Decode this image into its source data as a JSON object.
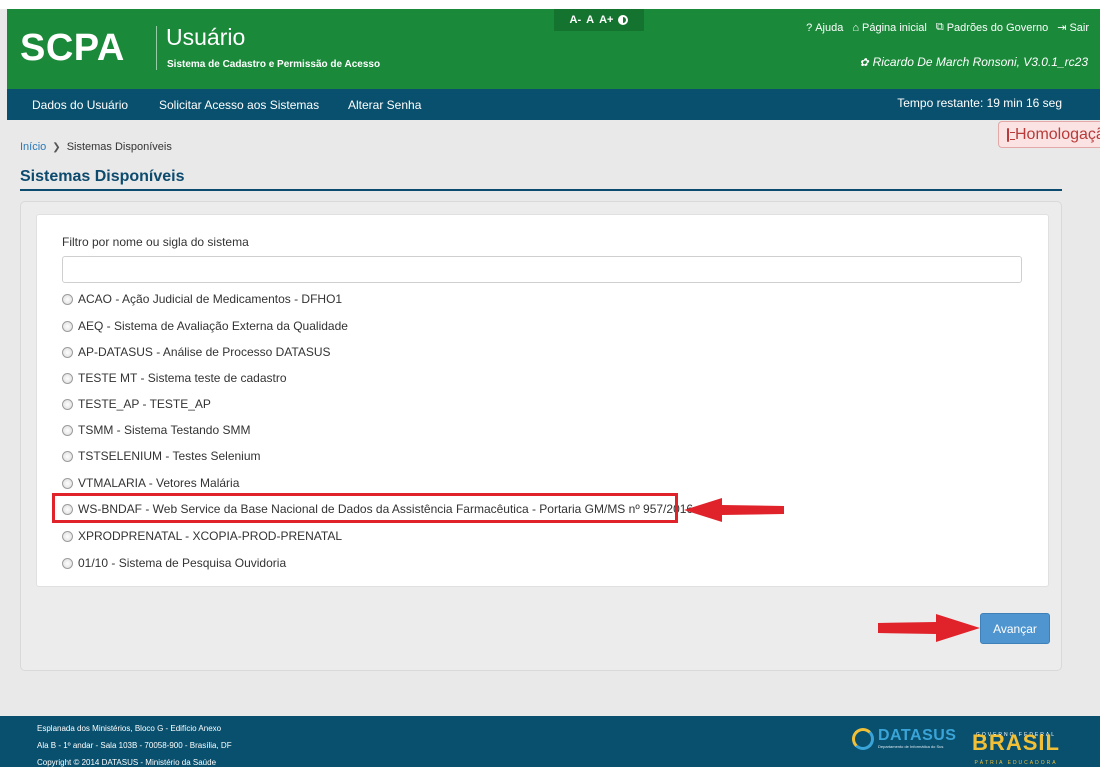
{
  "header": {
    "brand": "SCPA",
    "title": "Usuário",
    "subtitle": "Sistema de Cadastro e Permissão de Acesso",
    "font_controls": {
      "decrease": "A-",
      "normal": "A",
      "increase": "A+"
    },
    "links": {
      "help": "Ajuda",
      "home": "Página inicial",
      "standards": "Padrões do Governo",
      "logout": "Sair"
    },
    "user_info": "Ricardo De March Ronsoni, V3.0.1_rc23"
  },
  "nav": {
    "items": [
      {
        "label": "Dados do Usuário"
      },
      {
        "label": "Solicitar Acesso aos Sistemas"
      },
      {
        "label": "Alterar Senha"
      }
    ],
    "timer": "Tempo restante: 19 min 16 seg"
  },
  "env_badge": "Homologação",
  "breadcrumb": {
    "home": "Início",
    "current": "Sistemas Disponíveis"
  },
  "page_title": "Sistemas Disponíveis",
  "filter": {
    "label": "Filtro por nome ou sigla do sistema",
    "value": "",
    "placeholder": ""
  },
  "systems": [
    "ACAO - Ação Judicial de Medicamentos - DFHO1",
    "AEQ - Sistema de Avaliação Externa da Qualidade",
    "AP-DATASUS - Análise de Processo DATASUS",
    "TESTE MT - Sistema teste de cadastro",
    "TESTE_AP - TESTE_AP",
    "TSMM - Sistema Testando SMM",
    "TSTSELENIUM - Testes Selenium",
    "VTMALARIA - Vetores Malária",
    "WS-BNDAF - Web Service da Base Nacional de Dados da Assistência Farmacêutica - Portaria GM/MS nº 957/2016",
    "XPRODPRENATAL - XCOPIA-PROD-PRENATAL",
    "01/10 - Sistema de Pesquisa Ouvidoria"
  ],
  "next_button": "Avançar",
  "footer": {
    "lines": [
      "Esplanada dos Ministérios, Bloco G - Edifício Anexo",
      "Ala B - 1º andar - Sala 103B - 70058-900 - Brasília, DF",
      "Copyright © 2014 DATASUS - Ministério da Saúde"
    ],
    "datasus_name": "DATASUS",
    "datasus_sub": "Departamento de Informática do Sus",
    "gov_top": "GOVERNO FEDERAL",
    "gov_name": "BRASIL",
    "gov_bottom": "PÁTRIA EDUCADORA"
  },
  "colors": {
    "header_green": "#1a8a3a",
    "nav_blue": "#09506e",
    "accent_button": "#4f95d0",
    "annotation_red": "#e0232b"
  },
  "icons": {
    "contrast": "contrast-icon",
    "help": "question-icon",
    "home": "home-icon",
    "standards": "documents-icon",
    "logout": "logout-icon",
    "user": "gear-icon",
    "env": "document-icon"
  }
}
